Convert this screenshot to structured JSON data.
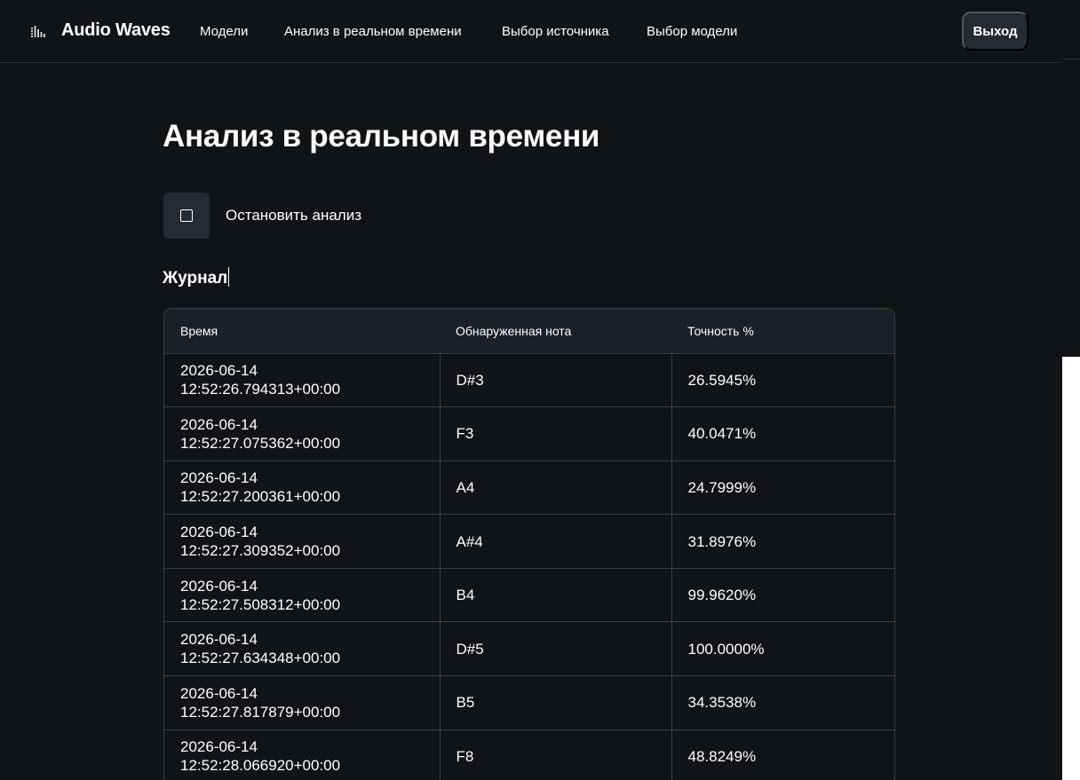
{
  "nav": {
    "brand": "Audio Waves",
    "brand_icon": "equalizer-icon",
    "links": [
      "Модели",
      "Анализ в реальном времени",
      "Выбор источника",
      "Выбор модели"
    ],
    "logout_label": "Выход"
  },
  "main": {
    "title": "Анализ в реальном времени",
    "stop_icon": "stop-icon",
    "stop_label": "Остановить анализ",
    "journal_title": "Журнал"
  },
  "table": {
    "headers": [
      "Время",
      "Обнаруженная нота",
      "Точность %"
    ],
    "rows": [
      {
        "date": "2026-06-14",
        "time": "12:52:26.794313+00:00",
        "note": "D#3",
        "accuracy": "26.5945%"
      },
      {
        "date": "2026-06-14",
        "time": "12:52:27.075362+00:00",
        "note": "F3",
        "accuracy": "40.0471%"
      },
      {
        "date": "2026-06-14",
        "time": "12:52:27.200361+00:00",
        "note": "A4",
        "accuracy": "24.7999%"
      },
      {
        "date": "2026-06-14",
        "time": "12:52:27.309352+00:00",
        "note": "A#4",
        "accuracy": "31.8976%"
      },
      {
        "date": "2026-06-14",
        "time": "12:52:27.508312+00:00",
        "note": "B4",
        "accuracy": "99.9620%"
      },
      {
        "date": "2026-06-14",
        "time": "12:52:27.634348+00:00",
        "note": "D#5",
        "accuracy": "100.0000%"
      },
      {
        "date": "2026-06-14",
        "time": "12:52:27.817879+00:00",
        "note": "B5",
        "accuracy": "34.3538%"
      },
      {
        "date": "2026-06-14",
        "time": "12:52:28.066920+00:00",
        "note": "F8",
        "accuracy": "48.8249%"
      }
    ]
  }
}
